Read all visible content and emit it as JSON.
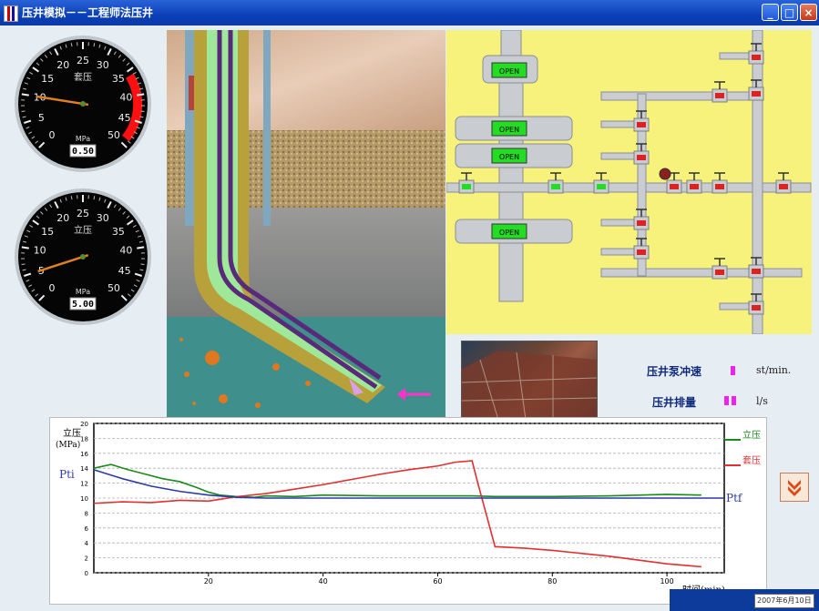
{
  "window": {
    "title": "压井模拟－－工程师法压井",
    "minimize_glyph": "_",
    "maximize_glyph": "□",
    "close_glyph": "×"
  },
  "gauges": {
    "casing": {
      "label": "套压",
      "unit": "MPa",
      "reading": "0.50",
      "ticks": [
        "0",
        "5",
        "10",
        "15",
        "20",
        "25",
        "30",
        "35",
        "40",
        "45",
        "50"
      ],
      "needle_value": 10,
      "max": 50,
      "red_zone_from": 38
    },
    "standpipe": {
      "label": "立压",
      "unit": "MPa",
      "reading": "5.00",
      "ticks": [
        "0",
        "5",
        "10",
        "15",
        "20",
        "25",
        "30",
        "35",
        "40",
        "45",
        "50"
      ],
      "needle_value": 5,
      "max": 50
    }
  },
  "manifold": {
    "valve_labels": [
      "OPEN",
      "OPEN",
      "OPEN",
      "OPEN"
    ]
  },
  "pump": {
    "stroke_label": "压井泵冲速",
    "stroke_unit": "st/min.",
    "rate_label": "压井排量",
    "rate_unit": "l/s"
  },
  "chart_data": {
    "type": "line",
    "ylabel": "立压\n(MPa)",
    "ylabel_line1": "立压",
    "ylabel_line2": "(MPa)",
    "xlabel": "时间(min)",
    "xlim": [
      0,
      110
    ],
    "ylim": [
      0,
      20
    ],
    "xticks": [
      "20",
      "40",
      "60",
      "80",
      "100"
    ],
    "yticks": [
      "0",
      "2",
      "4",
      "6",
      "8",
      "10",
      "12",
      "14",
      "16",
      "18",
      "20"
    ],
    "pti_label": "Pti",
    "ptf_label": "Ptf",
    "legend": [
      "立压",
      "套压"
    ],
    "series": [
      {
        "name": "立压",
        "color": "#1a8a1a",
        "x": [
          0,
          3,
          6,
          9,
          12,
          15,
          18,
          20,
          22,
          25,
          28,
          30,
          35,
          40,
          50,
          60,
          66,
          70,
          80,
          90,
          100,
          106
        ],
        "y": [
          14,
          14.5,
          13.8,
          13.2,
          12.6,
          12.2,
          11.4,
          10.8,
          10.4,
          10.2,
          10.1,
          10.3,
          10.2,
          10.4,
          10.3,
          10.3,
          10.3,
          10.2,
          10.2,
          10.3,
          10.5,
          10.4
        ]
      },
      {
        "name": "套压",
        "color": "#e03030",
        "x": [
          0,
          5,
          10,
          15,
          20,
          25,
          30,
          35,
          40,
          45,
          50,
          55,
          60,
          63,
          66,
          67,
          70,
          75,
          80,
          90,
          100,
          106
        ],
        "y": [
          9.3,
          9.5,
          9.4,
          9.7,
          9.6,
          10.2,
          10.6,
          11.2,
          11.8,
          12.5,
          13.2,
          13.8,
          14.3,
          14.8,
          15.0,
          12.0,
          3.5,
          3.3,
          3.0,
          2.2,
          1.2,
          0.8
        ]
      },
      {
        "name": "Ptf",
        "color": "#2a3aaa",
        "x": [
          0,
          5,
          10,
          15,
          20,
          25,
          30,
          40,
          60,
          80,
          100,
          110
        ],
        "y": [
          13.8,
          12.6,
          11.6,
          10.9,
          10.4,
          10.1,
          10.0,
          10.0,
          10.0,
          10.0,
          10.0,
          10.0
        ]
      }
    ]
  },
  "tray": {
    "clock": "2007年6月10日"
  },
  "colors": {
    "manifold_bg": "#f7f27c",
    "valve_open": "#22dd22",
    "valve_closed": "#dd2222",
    "mud": "#9fe89a",
    "casing": "#b8a03a"
  }
}
